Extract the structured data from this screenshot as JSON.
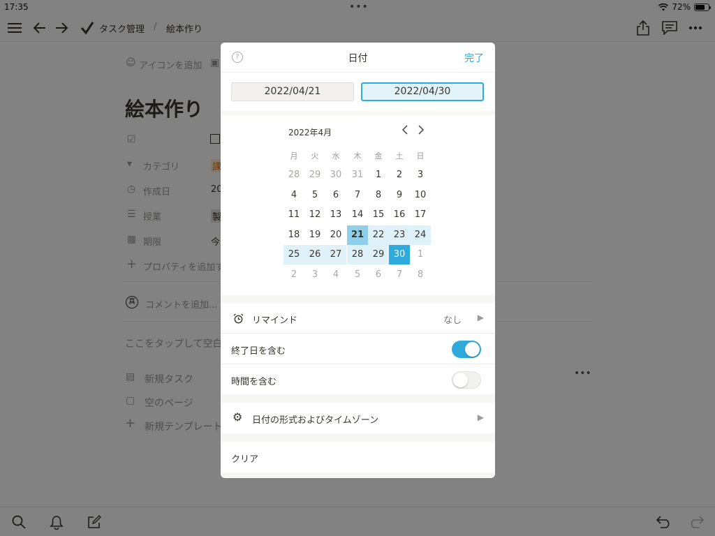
{
  "status": {
    "time": "17:35",
    "battery": "72%",
    "battery_level": 0.72
  },
  "nav": {
    "workspace": "タスク管理",
    "separator": "/",
    "page": "絵本作り"
  },
  "page": {
    "add_icon": "アイコンを追加",
    "title": "絵本作り",
    "props": {
      "category": "カテゴリ",
      "category_value": "課",
      "created": "作成日",
      "created_value": "20",
      "class": "授業",
      "class_value": "製",
      "deadline": "期限",
      "deadline_value": "今",
      "add_prop": "プロパティを追加す"
    },
    "comment": "コメントを追加...",
    "comment_avatar": "真",
    "empty_hint": "ここをタップして空白",
    "templates": [
      "新規タスク",
      "空のページ",
      "新規テンプレート"
    ]
  },
  "modal": {
    "title": "日付",
    "done": "完了",
    "help": "?",
    "start_date": "2022/04/21",
    "end_date": "2022/04/30",
    "calendar": {
      "month_label": "2022年4月",
      "weekdays": [
        "月",
        "火",
        "水",
        "木",
        "金",
        "土",
        "日"
      ],
      "weeks": [
        [
          "28",
          "29",
          "30",
          "31",
          "1",
          "2",
          "3"
        ],
        [
          "4",
          "5",
          "6",
          "7",
          "8",
          "9",
          "10"
        ],
        [
          "11",
          "12",
          "13",
          "14",
          "15",
          "16",
          "17"
        ],
        [
          "18",
          "19",
          "20",
          "21",
          "22",
          "23",
          "24"
        ],
        [
          "25",
          "26",
          "27",
          "28",
          "29",
          "30",
          "1"
        ],
        [
          "2",
          "3",
          "4",
          "5",
          "6",
          "7",
          "8"
        ]
      ]
    },
    "remind": {
      "label": "リマインド",
      "value": "なし"
    },
    "include_end": {
      "label": "終了日を含む",
      "on": true
    },
    "include_time": {
      "label": "時間を含む",
      "on": false
    },
    "format": {
      "label": "日付の形式およびタイムゾーン"
    },
    "clear": "クリア"
  },
  "colors": {
    "accent": "#2eaadc",
    "range": "#dff1f9",
    "range_start": "#8fcfea"
  }
}
